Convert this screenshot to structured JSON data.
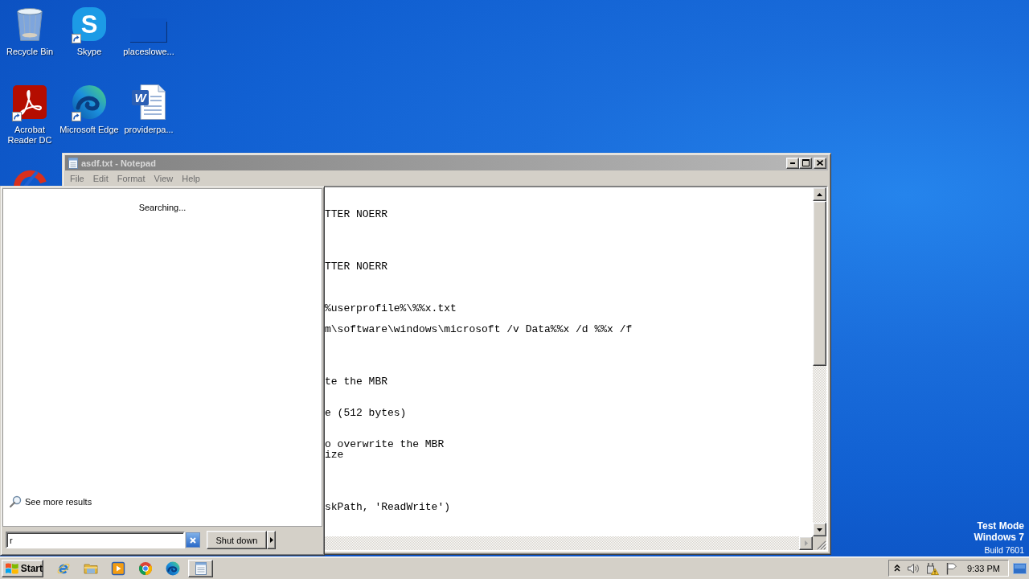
{
  "desktop": {
    "icons": [
      {
        "kind": "recycle-bin",
        "label": "Recycle Bin",
        "shortcut": false
      },
      {
        "kind": "skype",
        "label": "Skype",
        "letter": "S",
        "shortcut": true
      },
      {
        "kind": "image",
        "label": "placeslowe...",
        "shortcut": false
      },
      {
        "kind": "acrobat",
        "label": "Acrobat Reader DC",
        "shortcut": true
      },
      {
        "kind": "edge",
        "label": "Microsoft Edge",
        "shortcut": true
      },
      {
        "kind": "word-document",
        "label": "providerpa...",
        "letter": "W",
        "shortcut": false
      },
      {
        "kind": "cleaner",
        "shortcut": false
      }
    ],
    "notice": {
      "mode": "Test Mode",
      "edition": "Windows 7",
      "build": "Build 7601"
    }
  },
  "notepad": {
    "title": "asdf.txt - Notepad",
    "active": false,
    "menu": [
      "File",
      "Edit",
      "Format",
      "View",
      "Help"
    ],
    "lines": [
      "TTER NOERR",
      "TTER NOERR",
      "%userprofile%\\%%x.txt",
      "m\\software\\windows\\microsoft /v Data%%x /d %%x /f",
      "te the MBR",
      "e (512 bytes)",
      "o overwrite the MBR",
      "ize",
      "skPath, 'ReadWrite')"
    ]
  },
  "start_menu": {
    "status": "Searching...",
    "see_more": "See more results",
    "search": {
      "value": "r"
    },
    "shutdown": "Shut down"
  },
  "taskbar": {
    "start": "Start",
    "clock": "9:33 PM"
  }
}
